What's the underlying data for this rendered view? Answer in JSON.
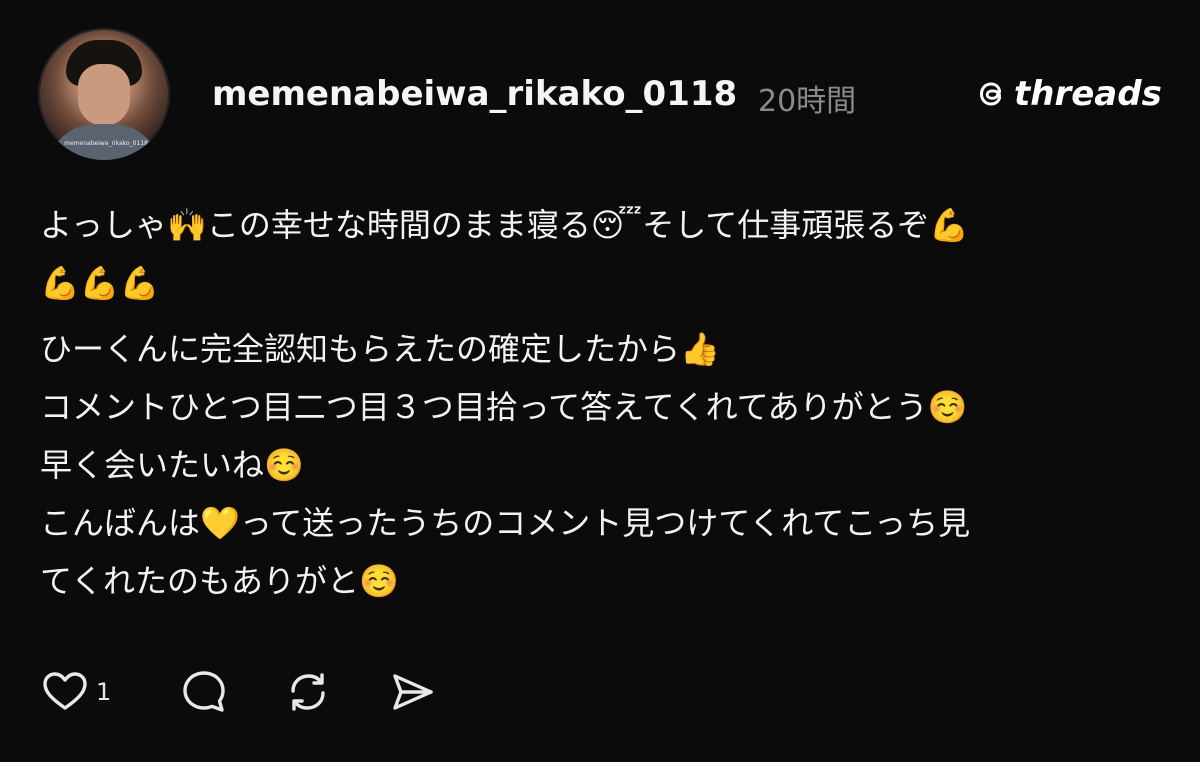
{
  "post": {
    "author": {
      "username": "memenabeiwa_rikako_0118",
      "avatar_watermark": "memenabeiwa_rikako_0118"
    },
    "time": "20時間",
    "brand": "threads",
    "body": {
      "paragraphs": [
        [
          "よっしゃ🙌この幸せな時間のまま寝る😴そして仕事頑張るぞ💪",
          "💪💪💪"
        ],
        [
          "ひーくんに完全認知もらえたの確定したから👍",
          "コメントひとつ目二つ目３つ目拾って答えてくれてありがとう☺️",
          "早く会いたいね☺️",
          "こんばんは💛って送ったうちのコメント見つけてくれてこっち見",
          "てくれたのもありがと☺️"
        ]
      ]
    },
    "actions": {
      "like_icon": "heart-outline",
      "like_count": "1",
      "reply_icon": "comment-bubble",
      "repost_icon": "repost-arrows",
      "share_icon": "send-arrow"
    }
  },
  "colors": {
    "background": "#0b0b0b",
    "text": "#f3f3f3",
    "muted": "#8a8a8a"
  }
}
